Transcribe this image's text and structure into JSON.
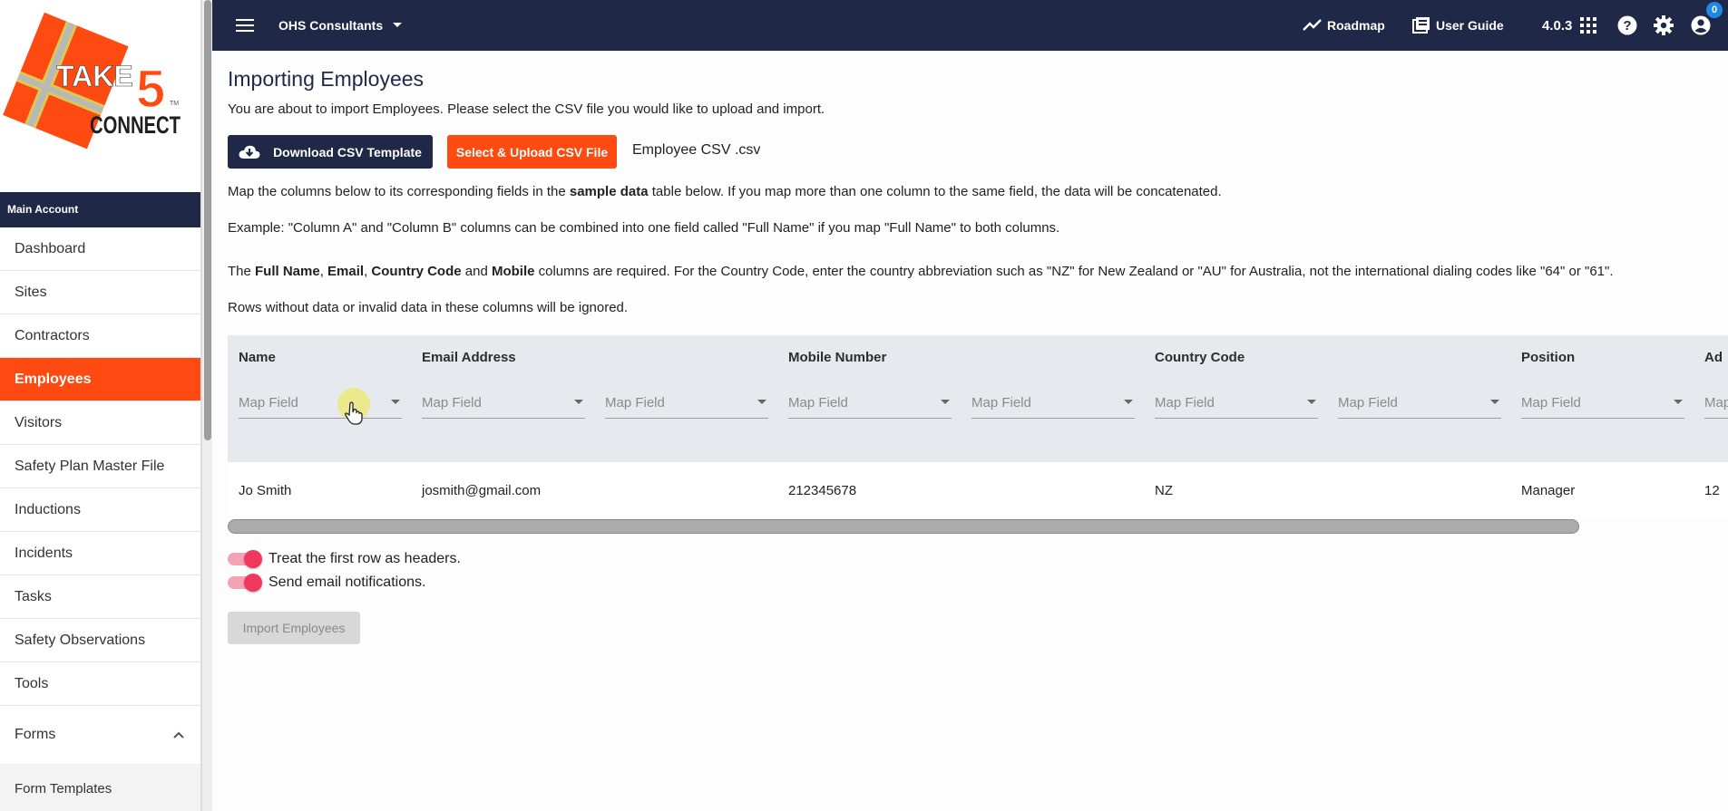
{
  "logo": {
    "line1": "TAKE",
    "big": "5",
    "line2": "CONNECT",
    "tm": "TM"
  },
  "sidebar": {
    "section": "Main Account",
    "items": [
      {
        "label": "Dashboard"
      },
      {
        "label": "Sites"
      },
      {
        "label": "Contractors"
      },
      {
        "label": "Employees"
      },
      {
        "label": "Visitors"
      },
      {
        "label": "Safety Plan Master File"
      },
      {
        "label": "Inductions"
      },
      {
        "label": "Incidents"
      },
      {
        "label": "Tasks"
      },
      {
        "label": "Safety Observations"
      },
      {
        "label": "Tools"
      },
      {
        "label": "Forms"
      }
    ],
    "subitem": "Form Templates"
  },
  "topbar": {
    "org": "OHS Consultants",
    "roadmap": "Roadmap",
    "user_guide": "User Guide",
    "version": "4.0.3",
    "badge": "0"
  },
  "main": {
    "title": "Importing Employees",
    "intro": "You are about to import Employees. Please select the CSV file you would like to upload and import.",
    "download_btn": "Download CSV Template",
    "upload_btn": "Select & Upload CSV File",
    "filename": "Employee CSV .csv",
    "map_pre": "Map the columns below to its corresponding fields in the ",
    "map_bold": "sample data",
    "map_post": " table below. If you map more than one column to the same field, the data will be concatenated.",
    "example": "Example: \"Column A\" and \"Column B\" columns can be combined into one field called \"Full Name\" if you map \"Full Name\" to both columns.",
    "req_the": "The ",
    "req_f1": "Full Name",
    "req_c1": ", ",
    "req_f2": "Email",
    "req_c2": ", ",
    "req_f3": "Country Code",
    "req_and": " and ",
    "req_f4": "Mobile",
    "req_post": " columns are required. For the Country Code, enter the country abbreviation such as \"NZ\" for New Zealand or \"AU\" for Australia, not the international dialing codes like \"64\" or \"61\".",
    "ignore": "Rows without data or invalid data in these columns will be ignored.",
    "table": {
      "headers": [
        "Name",
        "Email Address",
        "",
        "Mobile Number",
        "",
        "Country Code",
        "",
        "Position",
        "Ad"
      ],
      "map_placeholder": "Map Field",
      "row": [
        "Jo Smith",
        "josmith@gmail.com",
        "",
        "212345678",
        "",
        "NZ",
        "",
        "Manager",
        "12"
      ]
    },
    "toggle1": "Treat the first row as headers.",
    "toggle2": "Send email notifications.",
    "import_btn": "Import Employees"
  }
}
